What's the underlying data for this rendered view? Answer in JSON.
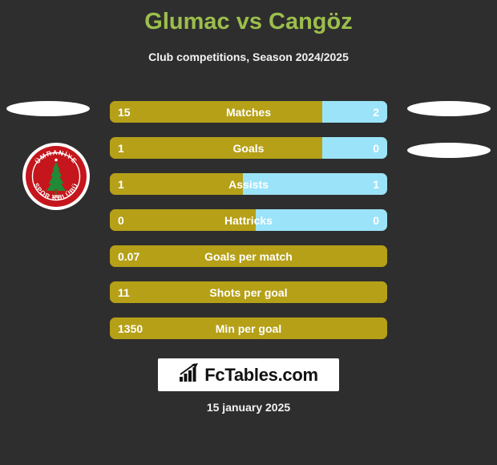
{
  "header": {
    "title": "Glumac vs Cangöz",
    "subtitle": "Club competitions, Season 2024/2025",
    "title_color": "#9cbe4c"
  },
  "theme": {
    "background": "#2e2e2e",
    "bar_left_color": "#b5a017",
    "bar_right_color": "#9be3f9",
    "text_color": "#ffffff"
  },
  "crest": {
    "club_name": "Ümraniyespor",
    "text_top": "ÜMRANİYE",
    "text_bottom": "SPOR KULÜBÜ",
    "year": "1986",
    "ring_color": "#c4161c",
    "tree_color": "#1f8b36"
  },
  "chart_data": {
    "type": "bar",
    "title": "Glumac vs Cangöz",
    "subtitle": "Club competitions, Season 2024/2025",
    "orientation": "horizontal-diverging",
    "series": [
      {
        "name": "Glumac",
        "color": "#b5a017"
      },
      {
        "name": "Cangöz",
        "color": "#9be3f9"
      }
    ],
    "categories": [
      "Matches",
      "Goals",
      "Assists",
      "Hattricks",
      "Goals per match",
      "Shots per goal",
      "Min per goal"
    ],
    "rows": [
      {
        "label": "Matches",
        "left_value": "15",
        "right_value": "2",
        "left_pct": 76.5,
        "split": true
      },
      {
        "label": "Goals",
        "left_value": "1",
        "right_value": "0",
        "left_pct": 76.5,
        "split": true
      },
      {
        "label": "Assists",
        "left_value": "1",
        "right_value": "1",
        "left_pct": 48.0,
        "split": true
      },
      {
        "label": "Hattricks",
        "left_value": "0",
        "right_value": "0",
        "left_pct": 52.5,
        "split": true
      },
      {
        "label": "Goals per match",
        "left_value": "0.07",
        "right_value": "",
        "left_pct": 100,
        "split": false
      },
      {
        "label": "Shots per goal",
        "left_value": "11",
        "right_value": "",
        "left_pct": 100,
        "split": false
      },
      {
        "label": "Min per goal",
        "left_value": "1350",
        "right_value": "",
        "left_pct": 100,
        "split": false
      }
    ]
  },
  "footer": {
    "brand": "FcTables.com",
    "date": "15 january 2025"
  }
}
